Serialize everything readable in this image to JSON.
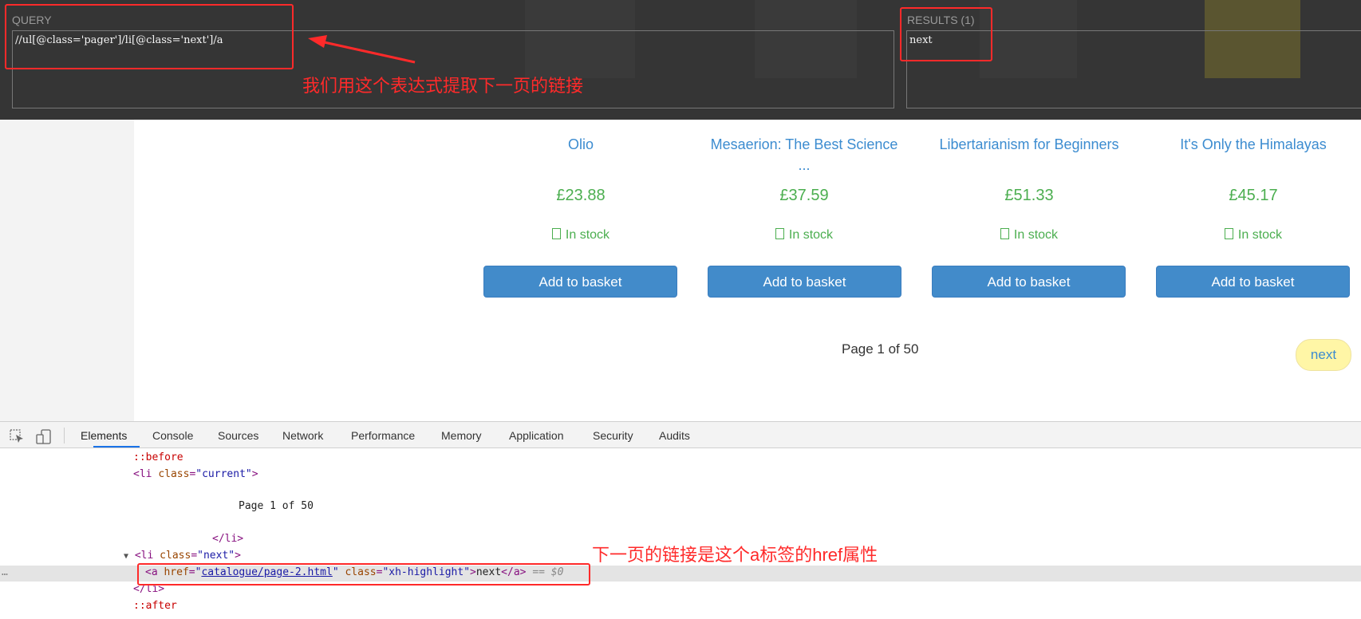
{
  "xpath_helper": {
    "query_label": "QUERY",
    "query_value": "//ul[@class='pager']/li[@class='next']/a",
    "results_label": "RESULTS (1)",
    "results_value": "next"
  },
  "annotations": {
    "query_note": "我们用这个表达式提取下一页的链接",
    "href_note": "下一页的链接是这个a标签的href属性"
  },
  "products": [
    {
      "title": "Olio",
      "title2": "",
      "price": "£23.88",
      "stock": "In stock",
      "button": "Add to basket"
    },
    {
      "title": "Mesaerion: The Best Science",
      "title2": "...",
      "price": "£37.59",
      "stock": "In stock",
      "button": "Add to basket"
    },
    {
      "title": "Libertarianism for Beginners",
      "title2": "",
      "price": "£51.33",
      "stock": "In stock",
      "button": "Add to basket"
    },
    {
      "title": "It's Only the Himalayas",
      "title2": "",
      "price": "£45.17",
      "stock": "In stock",
      "button": "Add to basket"
    }
  ],
  "pager": {
    "current": "Page 1 of 50",
    "next": "next"
  },
  "devtools": {
    "tabs": [
      "Elements",
      "Console",
      "Sources",
      "Network",
      "Performance",
      "Memory",
      "Application",
      "Security",
      "Audits"
    ],
    "active_tab": "Elements",
    "dom": {
      "before": "::before",
      "li_open": "<li",
      "class_attr": "class",
      "li_current_class": "\"current\"",
      "gt": ">",
      "page_text": "Page 1 of 50",
      "li_close": "</li>",
      "li_next_class": "\"next\"",
      "a_open": "<a",
      "href_attr": "href",
      "href_value": "catalogue/page-2.html",
      "a_class_value": "\"xh-highlight\"",
      "a_text": "next",
      "a_close": "</a>",
      "selected_marker": "== $0",
      "after": "::after",
      "ellipsis": "…",
      "expand_arrow": "▼",
      "eq": "=",
      "quote": "\""
    }
  },
  "colors": {
    "accent_red": "#ff2a2a",
    "link_blue": "#3c8cd0",
    "price_green": "#4bae4f",
    "button_blue": "#428bca",
    "next_yellow": "#fff6a6"
  }
}
